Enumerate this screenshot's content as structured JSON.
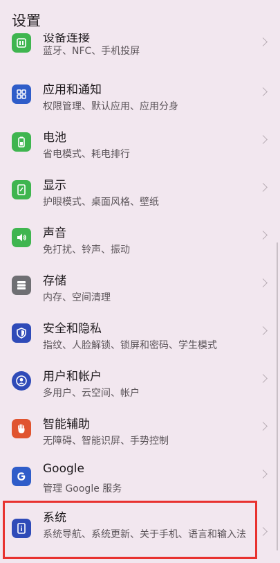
{
  "header": {
    "title": "设置"
  },
  "items": [
    {
      "label": "设备连接",
      "subtitle": "蓝牙、NFC、手机投屏",
      "icon": "device-connect-icon",
      "color": "#3fb54f"
    },
    {
      "label": "应用和通知",
      "subtitle": "权限管理、默认应用、应用分身",
      "icon": "apps-icon",
      "color": "#2f5dc9"
    },
    {
      "label": "电池",
      "subtitle": "省电模式、耗电排行",
      "icon": "battery-icon",
      "color": "#3fb54f"
    },
    {
      "label": "显示",
      "subtitle": "护眼模式、桌面风格、壁纸",
      "icon": "display-icon",
      "color": "#3fb54f"
    },
    {
      "label": "声音",
      "subtitle": "免打扰、铃声、振动",
      "icon": "sound-icon",
      "color": "#3fb54f"
    },
    {
      "label": "存储",
      "subtitle": "内存、空间清理",
      "icon": "storage-icon",
      "color": "#6f6f73"
    },
    {
      "label": "安全和隐私",
      "subtitle": "指纹、人脸解锁、锁屏和密码、学生模式",
      "icon": "shield-icon",
      "color": "#2f4bb8"
    },
    {
      "label": "用户和帐户",
      "subtitle": "多用户、云空间、帐户",
      "icon": "user-icon",
      "color": "#2f4bb8"
    },
    {
      "label": "智能辅助",
      "subtitle": "无障碍、智能识屏、手势控制",
      "icon": "hand-icon",
      "color": "#e0542f"
    },
    {
      "label": "Google",
      "subtitle": "管理 Google 服务",
      "icon": "google-icon",
      "color": "#2f5dc9"
    },
    {
      "label": "系统",
      "subtitle": "系统导航、系统更新、关于手机、语言和输入法",
      "icon": "system-info-icon",
      "color": "#2f4bb8"
    }
  ]
}
